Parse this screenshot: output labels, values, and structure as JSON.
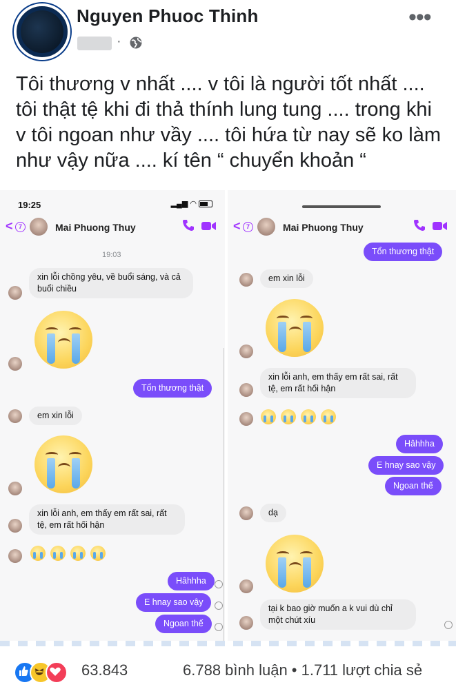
{
  "post": {
    "author": "Nguyen Phuoc Thinh",
    "separator": "·",
    "more": "•••",
    "text": "Tôi thương v nhất .... v tôi là người tốt nhất .... tôi thật tệ khi đi thả thính lung tung .... trong khi v tôi ngoan như vầy .... tôi hứa từ nay sẽ ko làm như vậy nữa .... kí tên “ chuyển khoản “"
  },
  "left_screen": {
    "time": "19:25",
    "back_badge": "7",
    "contact": "Mai Phuong Thuy",
    "timestamp": "19:03",
    "messages": [
      {
        "text": "xin lỗi chồng yêu, về buổi sáng, và cả buổi chiều"
      },
      {
        "text": "Tổn thương thật"
      },
      {
        "text": "em xin lỗi"
      },
      {
        "text": "xin lỗi anh, em thấy em rất sai, rất tệ, em rất hối hận"
      },
      {
        "text": "Hâhhha"
      },
      {
        "text": "E hnay sao vậy"
      },
      {
        "text": "Ngoan thế"
      }
    ]
  },
  "right_screen": {
    "back_badge": "7",
    "contact": "Mai Phuong Thuy",
    "messages": [
      {
        "text": "Tổn thương thật"
      },
      {
        "text": "em xin lỗi"
      },
      {
        "text": "xin lỗi anh, em thấy em rất sai, rất tệ, em rất hối hận"
      },
      {
        "text": "Hâhhha"
      },
      {
        "text": "E hnay sao vậy"
      },
      {
        "text": "Ngoan thế"
      },
      {
        "text": "dạ"
      },
      {
        "text": "tại k bao giờ muốn a k vui dù chỉ một chút xíu"
      }
    ]
  },
  "footer": {
    "reaction_count": "63.843",
    "stats": "6.788 bình luận • 1.711 lượt chia sẻ"
  },
  "colors": {
    "messenger_purple": "#7a4dfa",
    "facebook_blue": "#1877f2",
    "incoming_bubble": "#ececed"
  }
}
